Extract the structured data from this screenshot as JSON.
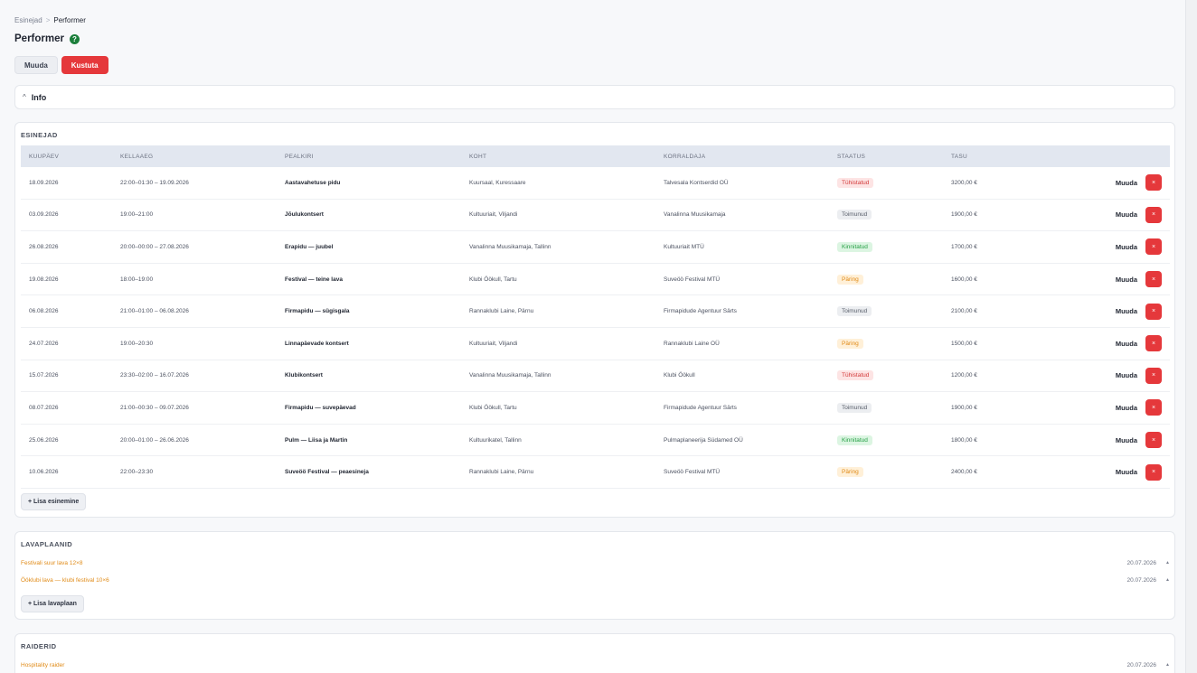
{
  "breadcrumb": {
    "parent": "Esinejad",
    "separator": ">",
    "current": "Performer"
  },
  "page": {
    "title": "Performer",
    "help_icon": "question-circle-icon"
  },
  "actions": {
    "edit_label": "Muuda",
    "delete_label": "Kustuta"
  },
  "info": {
    "label": "Info",
    "chevron": "^"
  },
  "esinejad": {
    "title": "ESINEJAD",
    "columns": [
      "KUUPÄEV",
      "KELLAAEG",
      "PEALKIRI",
      "KOHT",
      "KORRALDAJA",
      "STAATUS",
      "TASU"
    ],
    "rows": [
      {
        "date": "18.09.2026",
        "time": "22:00–01:30 – 19.09.2026",
        "title": "Aastavahetuse pidu",
        "place": "Kuursaal, Kuressaare",
        "organizer": "Talvesala Kontserdid OÜ",
        "status": "Tühistatud",
        "status_type": "red",
        "fee": "3200,00 €"
      },
      {
        "date": "03.09.2026",
        "time": "19:00–21:00",
        "title": "Jõulukontsert",
        "place": "Kultuuriait, Viljandi",
        "organizer": "Vanalinna Muusikamaja",
        "status": "Toimunud",
        "status_type": "gray",
        "fee": "1900,00 €"
      },
      {
        "date": "26.08.2026",
        "time": "20:00–00:00 – 27.08.2026",
        "title": "Erapidu — juubel",
        "place": "Vanalinna Muusikamaja, Tallinn",
        "organizer": "Kultuuriait MTÜ",
        "status": "Kinnitatud",
        "status_type": "green",
        "fee": "1700,00 €"
      },
      {
        "date": "19.08.2026",
        "time": "18:00–19:00",
        "title": "Festival — teine lava",
        "place": "Klubi Öökull, Tartu",
        "organizer": "Suveöö Festival MTÜ",
        "status": "Päring",
        "status_type": "orange",
        "fee": "1600,00 €"
      },
      {
        "date": "06.08.2026",
        "time": "21:00–01:00 – 06.08.2026",
        "title": "Firmapidu — sügisgala",
        "place": "Rannaklubi Laine, Pärnu",
        "organizer": "Firmapidude Agentuur Särts",
        "status": "Toimunud",
        "status_type": "gray",
        "fee": "2100,00 €"
      },
      {
        "date": "24.07.2026",
        "time": "19:00–20:30",
        "title": "Linnapäevade kontsert",
        "place": "Kultuuriait, Viljandi",
        "organizer": "Rannaklubi Laine OÜ",
        "status": "Päring",
        "status_type": "orange",
        "fee": "1500,00 €"
      },
      {
        "date": "15.07.2026",
        "time": "23:30–02:00 – 16.07.2026",
        "title": "Klubikontsert",
        "place": "Vanalinna Muusikamaja, Tallinn",
        "organizer": "Klubi Öökull",
        "status": "Tühistatud",
        "status_type": "red",
        "fee": "1200,00 €"
      },
      {
        "date": "08.07.2026",
        "time": "21:00–00:30 – 09.07.2026",
        "title": "Firmapidu — suvepäevad",
        "place": "Klubi Öökull, Tartu",
        "organizer": "Firmapidude Agentuur Särts",
        "status": "Toimunud",
        "status_type": "gray",
        "fee": "1900,00 €"
      },
      {
        "date": "25.06.2026",
        "time": "20:00–01:00 – 26.06.2026",
        "title": "Pulm — Liisa ja Martin",
        "place": "Kultuurikatel, Tallinn",
        "organizer": "Pulmaplaneerija Südamed OÜ",
        "status": "Kinnitatud",
        "status_type": "green",
        "fee": "1800,00 €"
      },
      {
        "date": "10.06.2026",
        "time": "22:00–23:30",
        "title": "Suveöö Festival — peaesineja",
        "place": "Rannaklubi Laine, Pärnu",
        "organizer": "Suveöö Festival MTÜ",
        "status": "Päring",
        "status_type": "orange",
        "fee": "2400,00 €"
      }
    ],
    "row_edit_label": "Muuda",
    "row_delete_label": "×",
    "add_label": "+ Lisa esinemine"
  },
  "lavaplaanid": {
    "title": "LAVAPLAANID",
    "items": [
      {
        "name": "Festivali suur lava 12×8",
        "date": "20.07.2026",
        "arrow": "▲"
      },
      {
        "name": "Ööklubi lava — klubi festival 10×6",
        "date": "20.07.2026",
        "arrow": "▲"
      }
    ],
    "add_label": "+ Lisa lavaplaan"
  },
  "raiderid": {
    "title": "RAIDERID",
    "items": [
      {
        "name": "Hospitality raider",
        "date": "20.07.2026",
        "arrow": "▲"
      }
    ]
  },
  "colors": {
    "danger": "#e5383b",
    "accent_orange": "#e08a16",
    "help_green": "#1b7f3b",
    "header_bg": "#e2e7f0"
  }
}
